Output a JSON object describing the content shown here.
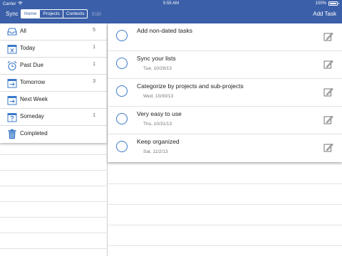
{
  "status": {
    "carrier": "Carrier",
    "time": "5:55 AM",
    "battery": "100%",
    "battery_level": 1.0
  },
  "header": {
    "sync_label": "Sync",
    "tabs": [
      {
        "label": "Home",
        "active": true
      },
      {
        "label": "Projects",
        "active": false
      },
      {
        "label": "Contexts",
        "active": false
      }
    ],
    "edit_label": "Edit",
    "add_task_label": "Add Task",
    "bar_color": "#3b5fa8"
  },
  "sidebar": {
    "items": [
      {
        "label": "All",
        "count": "5",
        "icon": "inbox-icon"
      },
      {
        "label": "Today",
        "count": "1",
        "icon": "calendar-x-icon"
      },
      {
        "label": "Past Due",
        "count": "1",
        "icon": "alarm-clock-icon"
      },
      {
        "label": "Tomorrow",
        "count": "3",
        "icon": "calendar-arrow-icon"
      },
      {
        "label": "Next Week",
        "count": "",
        "icon": "calendar-arrow-icon"
      },
      {
        "label": "Someday",
        "count": "1",
        "icon": "calendar-question-icon"
      },
      {
        "label": "Completed",
        "count": "",
        "icon": "trash-icon"
      }
    ]
  },
  "tasks": [
    {
      "title": "Add non-dated tasks",
      "date": ""
    },
    {
      "title": "Sync your lists",
      "date": "Tue, 10/29/13"
    },
    {
      "title": "Categorize by projects and sub-projects",
      "date": "Wed, 10/30/13"
    },
    {
      "title": "Very easy to use",
      "date": "Thu, 10/31/13"
    },
    {
      "title": "Keep organized",
      "date": "Sat, 11/2/13"
    }
  ],
  "accent_color": "#3a79c7"
}
